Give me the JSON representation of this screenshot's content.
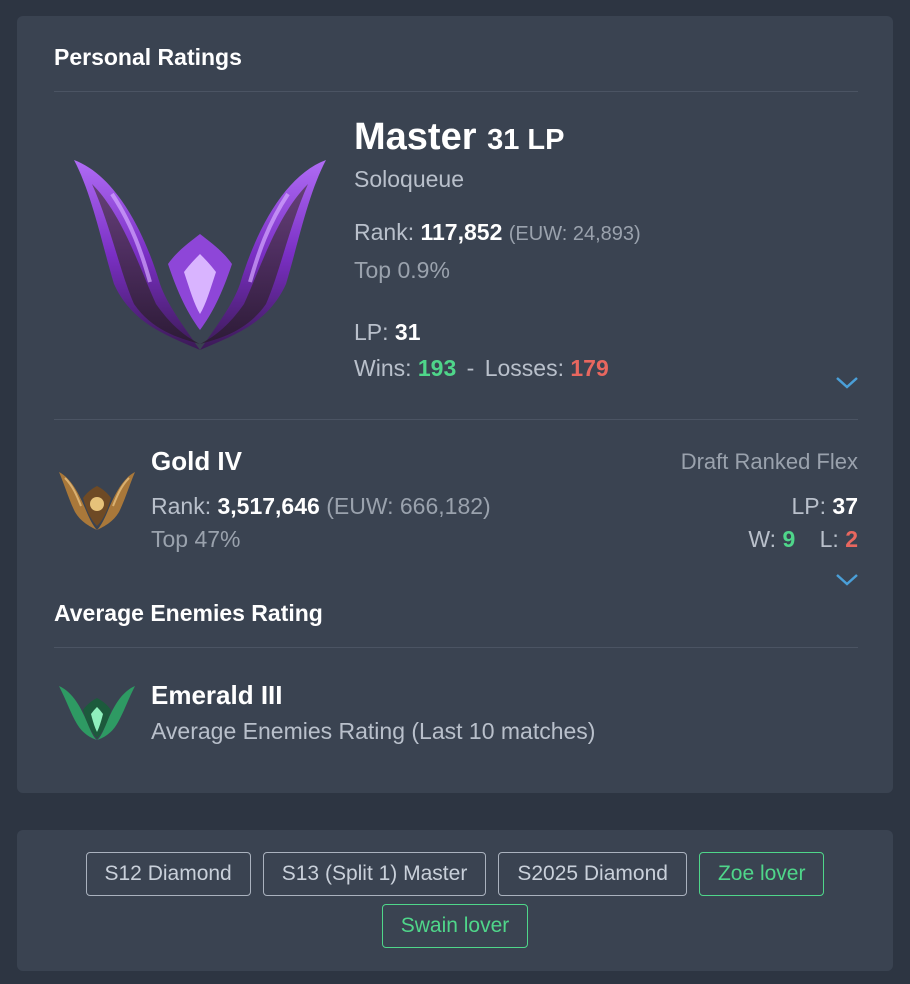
{
  "personal": {
    "title": "Personal Ratings",
    "solo": {
      "tier": "Master",
      "lp_header": "31 LP",
      "queue": "Soloqueue",
      "rank_label": "Rank:",
      "rank": "117,852",
      "region_rank": "(EUW: 24,893)",
      "top": "Top 0.9%",
      "lp_label": "LP:",
      "lp": "31",
      "wins_label": "Wins:",
      "wins": "193",
      "sep": "-",
      "losses_label": "Losses:",
      "losses": "179"
    },
    "flex": {
      "tier": "Gold IV",
      "queue": "Draft Ranked Flex",
      "rank_label": "Rank:",
      "rank": "3,517,646",
      "region_rank": "(EUW: 666,182)",
      "top": "Top 47%",
      "lp_label": "LP:",
      "lp": "37",
      "w_label": "W:",
      "w": "9",
      "l_label": "L:",
      "l": "2"
    }
  },
  "enemies": {
    "title": "Average Enemies Rating",
    "tier": "Emerald III",
    "desc": "Average Enemies Rating (Last 10 matches)"
  },
  "tags": [
    {
      "label": "S12 Diamond"
    },
    {
      "label": "S13 (Split 1) Master"
    },
    {
      "label": "S2025 Diamond"
    },
    {
      "label": "Zoe lover"
    },
    {
      "label": "Swain lover"
    }
  ],
  "colors": {
    "background": "#2d3542",
    "card": "#3a4351",
    "win": "#4fd68a",
    "loss": "#e8675f",
    "accent": "#4a9fd8",
    "master_emblem": "#9b3fe0",
    "gold_emblem": "#a9783a",
    "emerald_emblem": "#2e9a63"
  },
  "icons": {
    "master": "master-emblem-icon",
    "gold": "gold-emblem-icon",
    "emerald": "emerald-emblem-icon",
    "expand": "chevron-down-icon"
  }
}
